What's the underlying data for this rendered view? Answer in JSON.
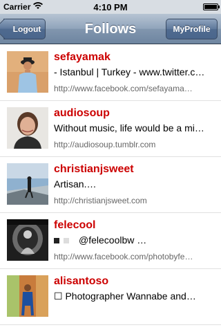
{
  "status_bar": {
    "carrier": "Carrier",
    "time": "4:10 PM"
  },
  "nav": {
    "title": "Follows",
    "left_button": "Logout",
    "right_button": "MyProfile"
  },
  "users": [
    {
      "name": "sefayamak",
      "description": "- Istanbul | Turkey - www.twitter.c…",
      "url": "http://www.facebook.com/sefayama…"
    },
    {
      "name": "audiosoup",
      "description": "Without music, life would be a mi…",
      "url": "http://audiosoup.tumblr.com"
    },
    {
      "name": "christianjsweet",
      "description": "Artisan.…",
      "url": "http://christianjsweet.com"
    },
    {
      "name": "felecool",
      "description": "@felecoolbw …",
      "url": "http://www.facebook.com/photobyfe…"
    },
    {
      "name": "alisantoso",
      "description": "☐ Photographer Wannabe and…",
      "url": ""
    }
  ]
}
